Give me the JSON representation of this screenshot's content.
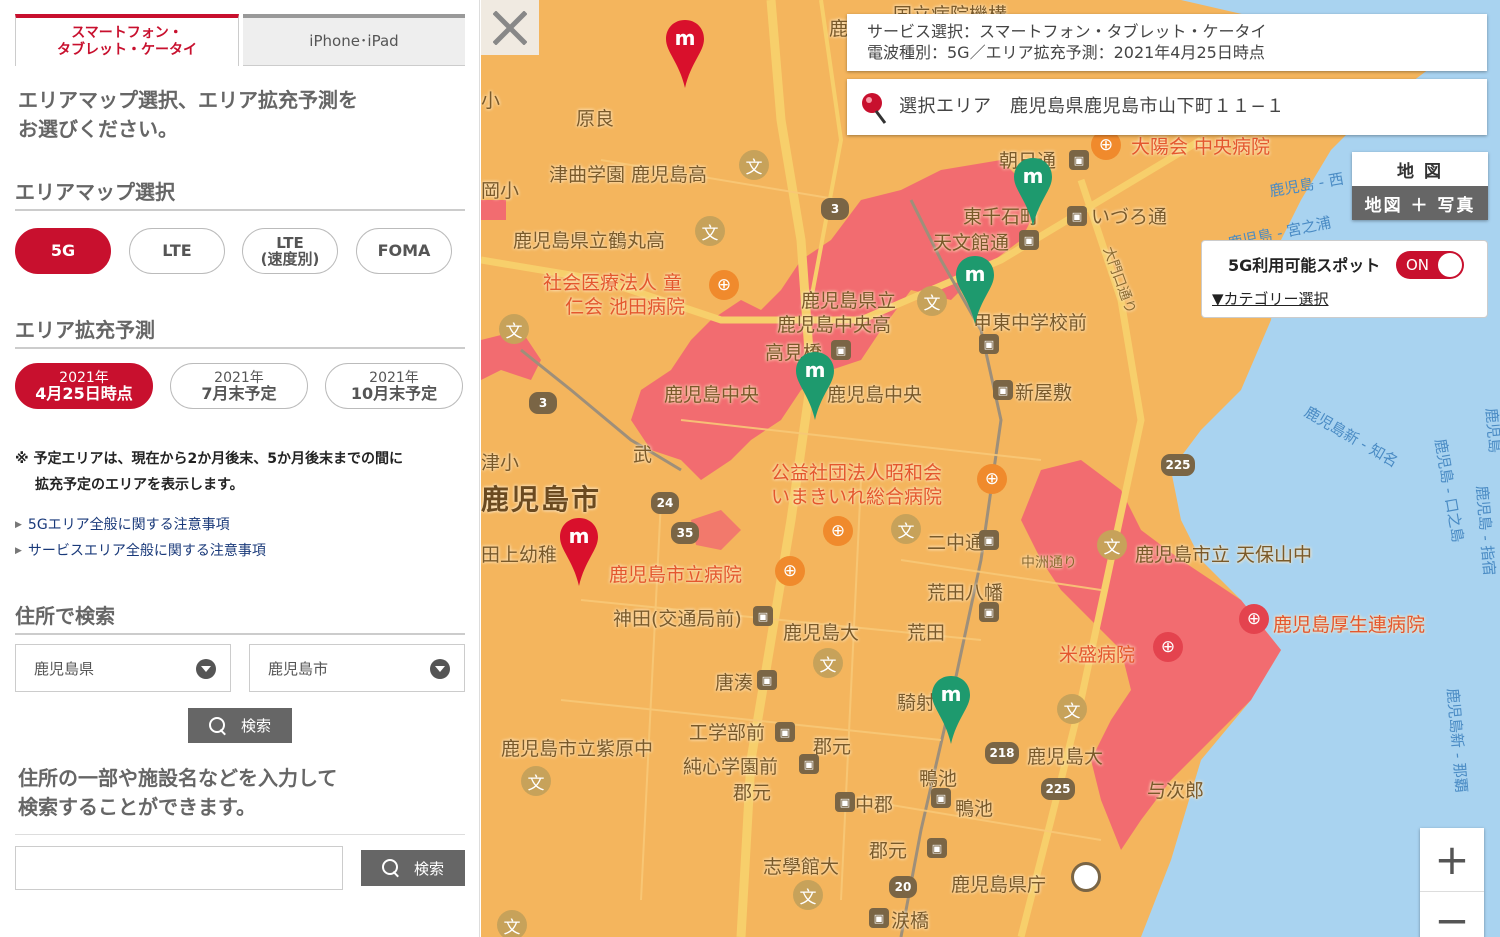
{
  "tabs": {
    "smartphone": "スマートフォン・\nタブレット・ケータイ",
    "iphone": "iPhone･iPad"
  },
  "lead": "エリアマップ選択、エリア拡充予測を\nお選びください。",
  "area_map": {
    "heading": "エリアマップ選択",
    "options": [
      {
        "label": "5G",
        "selected": true
      },
      {
        "label": "LTE",
        "selected": false
      },
      {
        "label": "LTE\n(速度別)",
        "selected": false
      },
      {
        "label": "FOMA",
        "selected": false
      }
    ]
  },
  "forecast": {
    "heading": "エリア拡充予測",
    "options": [
      {
        "year": "2021年",
        "label": "4月25日時点",
        "selected": true
      },
      {
        "year": "2021年",
        "label": "7月末予定",
        "selected": false
      },
      {
        "year": "2021年",
        "label": "10月末予定",
        "selected": false
      }
    ]
  },
  "note": {
    "line1": "※ 予定エリアは、現在から2か月後末、5か月後末までの間に",
    "line2": "拡充予定のエリアを表示します。"
  },
  "links": [
    "5Gエリア全般に関する注意事項",
    "サービスエリア全般に関する注意事項"
  ],
  "address_search": {
    "heading": "住所で検索",
    "prefecture": "鹿児島県",
    "city": "鹿児島市",
    "button": "検索"
  },
  "keyword_search": {
    "hint": "住所の一部や施設名などを入力して\n検索することができます。",
    "value": "",
    "button": "検索"
  },
  "map": {
    "info_line1": "サービス選択：スマートフォン・タブレット・ケータイ",
    "info_line2": "電波種別：5G／エリア拡充予測：2021年4月25日時点",
    "selected_area": "選択エリア　鹿児島県鹿児島市山下町１１−１",
    "map_type": {
      "map": "地 図",
      "map_photo": "地図 ＋ 写真"
    },
    "spot": {
      "label": "5G利用可能スポット",
      "toggle": "ON",
      "category": "▼カテゴリー選択"
    },
    "zoom_in": "+",
    "zoom_out": "−",
    "close": "×",
    "labels": {
      "l01": "国立病院機構",
      "l02": "鹿児島",
      "l03": "原良",
      "l04": "津曲学園 鹿児島高",
      "l05": "鹿児島県立鶴丸高",
      "l06": "社会医療法人 童",
      "l07": "仁会 池田病院",
      "l08": "鹿児島県立",
      "l09": "鹿児島中央高",
      "l10": "高見橋",
      "l11": "鹿児島中央",
      "l12": "鹿児島中央",
      "l13": "朝日通",
      "l14": "東千石町",
      "l15": "いづろ通",
      "l16": "天文館通",
      "l17": "甲東中学校前",
      "l18": "新屋敷",
      "l19": "大陽会 中央病院",
      "l20": "公益社団法人昭和会",
      "l21": "いまきいれ総合病院",
      "l22": "鹿児島市",
      "l23": "田上幼稚",
      "l24": "鹿児島市立病院",
      "l25": "二中通",
      "l26": "荒田八幡",
      "l27": "神田(交通局前)",
      "l28": "鹿児島大",
      "l29": "荒田",
      "l30": "唐湊",
      "l31": "工学部前",
      "l32": "郡元",
      "l33": "鹿児島市立紫原中",
      "l34": "純心学園前",
      "l35": "郡元",
      "l36": "騎射場",
      "l37": "鴨池",
      "l38": "鴨池",
      "l39": "中郡",
      "l40": "鹿児島大",
      "l41": "与次郎",
      "l42": "郡元",
      "l43": "志學館大",
      "l44": "鹿児島県庁",
      "l45": "涙橋",
      "l46": "鹿児島市立 天保山中",
      "l47": "鹿児島厚生連病院",
      "l48": "米盛病院",
      "l49": "武",
      "l50": "小",
      "l51": "岡小",
      "l52": "津小",
      "l53": "中洲通り",
      "l54": "大門口通り"
    },
    "sea_labels": {
      "s1": "鹿児島 - 西",
      "s2": "鹿児島 - 宮之浦",
      "s3": "鹿児島新 - 知名",
      "s4": "鹿児島 - 口之島",
      "s5": "鹿児島新 - 那覇",
      "s6": "鹿児島 - 指宿",
      "s7": "鹿児島"
    },
    "roads": [
      "3",
      "3",
      "24",
      "35",
      "225",
      "218",
      "225",
      "20"
    ]
  }
}
